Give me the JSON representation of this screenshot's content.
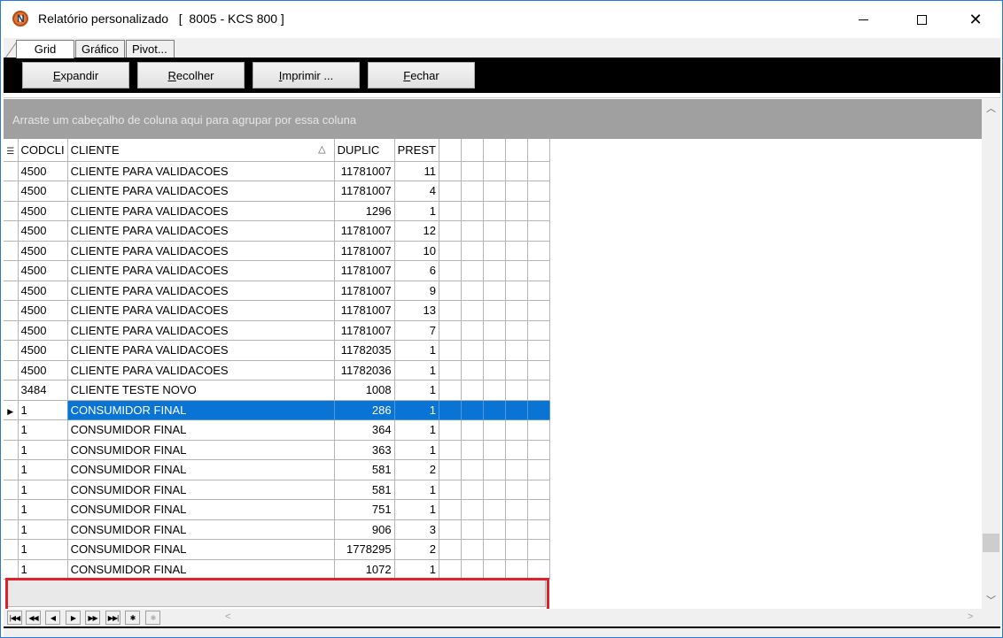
{
  "window": {
    "title": "Relatório personalizado   [  8005 - KCS 800 ]"
  },
  "tabs": [
    {
      "label": "Grid"
    },
    {
      "label": "Gráfico"
    },
    {
      "label": "Pivot..."
    }
  ],
  "toolbar": {
    "expand_first": "E",
    "expand_rest": "xpandir",
    "collapse_first": "R",
    "collapse_rest": "ecolher",
    "print_first": "I",
    "print_rest": "mprimir ...",
    "close_first": "F",
    "close_rest": "echar"
  },
  "group_panel": {
    "hint": "Arraste um cabeçalho de coluna aqui para agrupar por essa coluna"
  },
  "grid": {
    "columns": [
      "CODCLI",
      "CLIENTE",
      "DUPLIC",
      "PREST"
    ],
    "rows": [
      [
        "4500",
        "CLIENTE PARA VALIDACOES",
        "11781007",
        "11"
      ],
      [
        "4500",
        "CLIENTE PARA VALIDACOES",
        "11781007",
        "4"
      ],
      [
        "4500",
        "CLIENTE PARA VALIDACOES",
        "1296",
        "1"
      ],
      [
        "4500",
        "CLIENTE PARA VALIDACOES",
        "11781007",
        "12"
      ],
      [
        "4500",
        "CLIENTE PARA VALIDACOES",
        "11781007",
        "10"
      ],
      [
        "4500",
        "CLIENTE PARA VALIDACOES",
        "11781007",
        "6"
      ],
      [
        "4500",
        "CLIENTE PARA VALIDACOES",
        "11781007",
        "9"
      ],
      [
        "4500",
        "CLIENTE PARA VALIDACOES",
        "11781007",
        "13"
      ],
      [
        "4500",
        "CLIENTE PARA VALIDACOES",
        "11781007",
        "7"
      ],
      [
        "4500",
        "CLIENTE PARA VALIDACOES",
        "11782035",
        "1"
      ],
      [
        "4500",
        "CLIENTE PARA VALIDACOES",
        "11782036",
        "1"
      ],
      [
        "3484",
        "CLIENTE TESTE NOVO",
        "1008",
        "1"
      ],
      [
        "1",
        "CONSUMIDOR FINAL",
        "286",
        "1"
      ],
      [
        "1",
        "CONSUMIDOR FINAL",
        "364",
        "1"
      ],
      [
        "1",
        "CONSUMIDOR FINAL",
        "363",
        "1"
      ],
      [
        "1",
        "CONSUMIDOR FINAL",
        "581",
        "2"
      ],
      [
        "1",
        "CONSUMIDOR FINAL",
        "581",
        "1"
      ],
      [
        "1",
        "CONSUMIDOR FINAL",
        "751",
        "1"
      ],
      [
        "1",
        "CONSUMIDOR FINAL",
        "906",
        "3"
      ],
      [
        "1",
        "CONSUMIDOR FINAL",
        "1778295",
        "2"
      ],
      [
        "1",
        "CONSUMIDOR FINAL",
        "1072",
        "1"
      ]
    ],
    "selected_row": 12,
    "sort_column": "CLIENTE",
    "extra_empty_columns": 5
  },
  "navigator": {
    "buttons": [
      "first-icon",
      "prior-page-icon",
      "prior-icon",
      "next-icon",
      "next-page-icon",
      "last-icon",
      "insert-icon",
      "delete-icon"
    ]
  },
  "colors": {
    "selection": "#0a74d4",
    "group_panel": "#a0a0a0",
    "toolbar": "#000000",
    "highlight_box": "#e0202a"
  }
}
